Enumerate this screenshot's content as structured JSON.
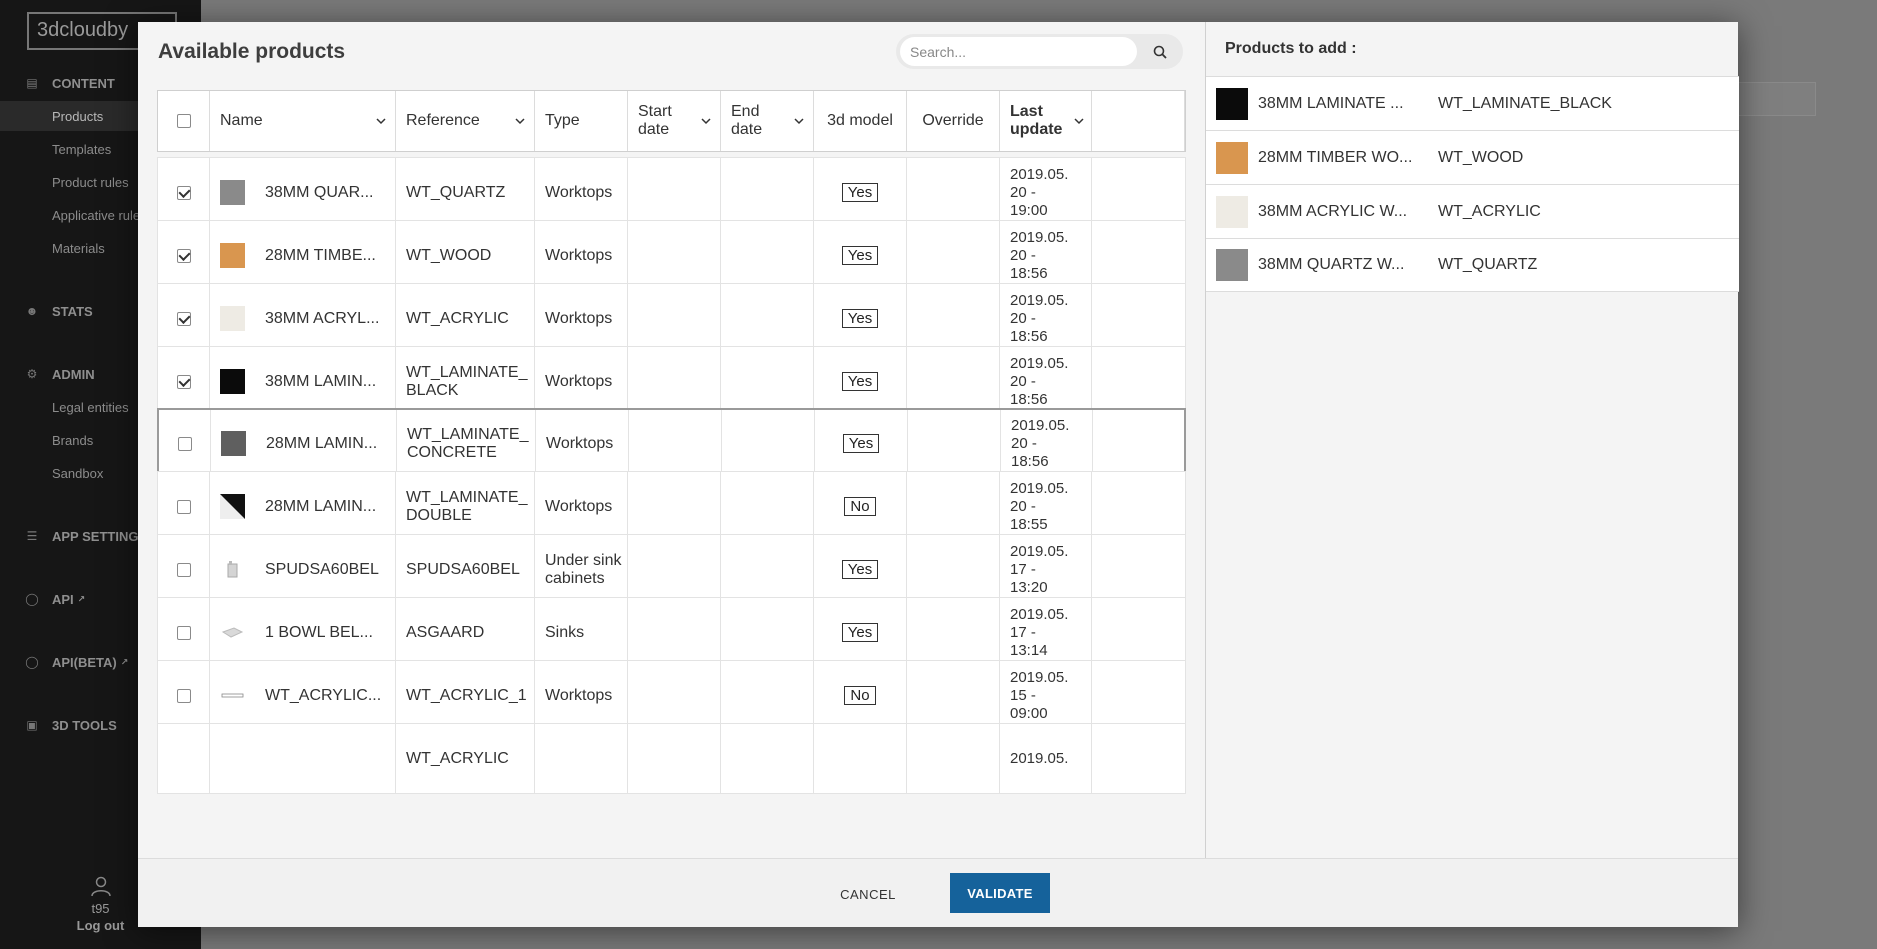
{
  "app": {
    "logo": "3dcloudby",
    "nav": {
      "content": "CONTENT",
      "products": "Products",
      "templates": "Templates",
      "product_rules": "Product rules",
      "applicative_rules": "Applicative rules",
      "materials": "Materials",
      "stats": "STATS",
      "admin": "ADMIN",
      "legal_entities": "Legal entities",
      "brands": "Brands",
      "sandbox": "Sandbox",
      "app_settings": "APP SETTINGS",
      "api": "API",
      "api_beta": "API(BETA)",
      "tools_3d": "3D TOOLS"
    },
    "user": {
      "name": "t95",
      "logout": "Log out"
    }
  },
  "modal": {
    "title": "Available products",
    "search_placeholder": "Search...",
    "columns": {
      "name": "Name",
      "reference": "Reference",
      "type": "Type",
      "start_date": "Start date",
      "end_date": "End date",
      "model_3d": "3d model",
      "override": "Override",
      "last_update": "Last update"
    },
    "rows": [
      {
        "checked": true,
        "name": "38MM QUAR...",
        "reference": "WT_QUARTZ",
        "type": "Worktops",
        "model": "Yes",
        "last_update": "2019.05. 20 - 19:00",
        "thumb_color": "#8a8a8a"
      },
      {
        "checked": true,
        "name": "28MM TIMBE...",
        "reference": "WT_WOOD",
        "type": "Worktops",
        "model": "Yes",
        "last_update": "2019.05. 20 - 18:56",
        "thumb_color": "#d9964f"
      },
      {
        "checked": true,
        "name": "38MM ACRYL...",
        "reference": "WT_ACRYLIC",
        "type": "Worktops",
        "model": "Yes",
        "last_update": "2019.05. 20 - 18:56",
        "thumb_color": "#eeebe4"
      },
      {
        "checked": true,
        "name": "38MM LAMIN...",
        "reference": "WT_LAMINATE_BLACK",
        "type": "Worktops",
        "model": "Yes",
        "last_update": "2019.05. 20 - 18:56",
        "thumb_color": "#0b0b0b"
      },
      {
        "checked": false,
        "name": "28MM LAMIN...",
        "reference": "WT_LAMINATE_CONCRETE",
        "type": "Worktops",
        "model": "Yes",
        "last_update": "2019.05. 20 - 18:56",
        "thumb_color": "#5f5f5f"
      },
      {
        "checked": false,
        "name": "28MM LAMIN...",
        "reference": "WT_LAMINATE_DOUBLE",
        "type": "Worktops",
        "model": "No",
        "last_update": "2019.05. 20 - 18:55",
        "thumb_color": "#111111"
      },
      {
        "checked": false,
        "name": "SPUDSA60BEL",
        "reference": "SPUDSA60BEL",
        "type": "Under sink cabinets",
        "model": "Yes",
        "last_update": "2019.05. 17 - 13:20",
        "thumb_color": "#d8d8d8"
      },
      {
        "checked": false,
        "name": "1 BOWL BEL...",
        "reference": "ASGAARD",
        "type": "Sinks",
        "model": "Yes",
        "last_update": "2019.05. 17 - 13:14",
        "thumb_color": "#d0d0d0"
      },
      {
        "checked": false,
        "name": "WT_ACRYLIC...",
        "reference": "WT_ACRYLIC_1",
        "type": "Worktops",
        "model": "No",
        "last_update": "2019.05. 15 - 09:00",
        "thumb_color": "#e6e6e6"
      },
      {
        "checked": false,
        "name": "",
        "reference": "WT_ACRYLIC",
        "type": "",
        "model": "",
        "last_update": "2019.05.",
        "thumb_color": "#ffffff"
      }
    ],
    "products_to_add": {
      "title": "Products to add :",
      "items": [
        {
          "name": "38MM LAMINATE ...",
          "reference": "WT_LAMINATE_BLACK",
          "thumb_color": "#0b0b0b"
        },
        {
          "name": "28MM TIMBER WO...",
          "reference": "WT_WOOD",
          "thumb_color": "#d9964f"
        },
        {
          "name": "38MM ACRYLIC W...",
          "reference": "WT_ACRYLIC",
          "thumb_color": "#eeebe4"
        },
        {
          "name": "38MM QUARTZ W...",
          "reference": "WT_QUARTZ",
          "thumb_color": "#8a8a8a"
        }
      ]
    },
    "footer": {
      "cancel": "CANCEL",
      "validate": "VALIDATE"
    }
  }
}
